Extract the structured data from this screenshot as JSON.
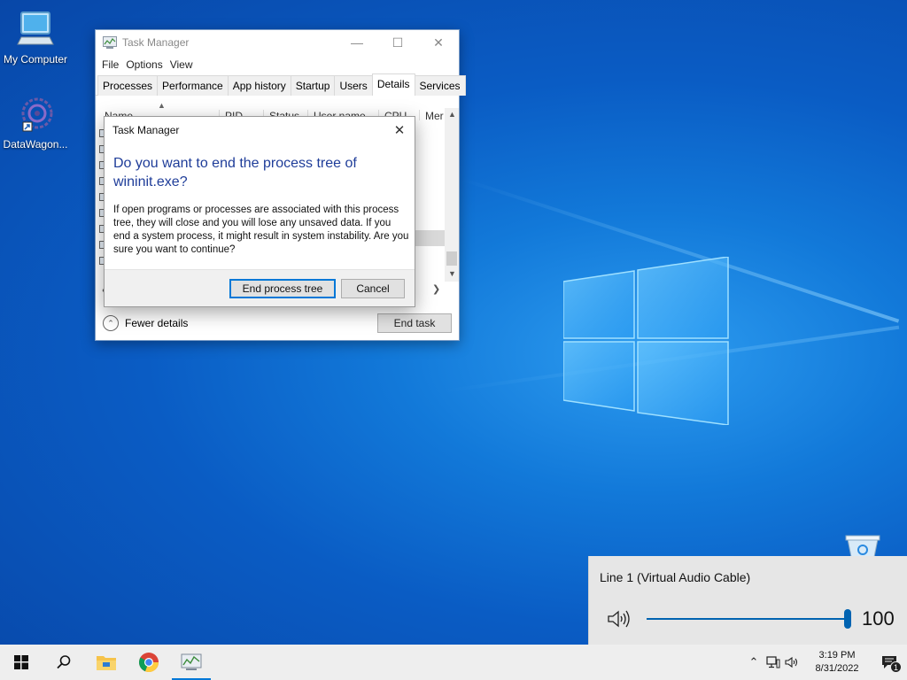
{
  "desktop": {
    "icons": [
      {
        "label": "My Computer",
        "icon": "computer-icon"
      },
      {
        "label": "DataWagon...",
        "icon": "shortcut-app-icon"
      },
      {
        "label": "",
        "icon": "recycle-bin-icon"
      }
    ]
  },
  "task_manager": {
    "title": "Task Manager",
    "menu": [
      "File",
      "Options",
      "View"
    ],
    "tabs": [
      "Processes",
      "Performance",
      "App history",
      "Startup",
      "Users",
      "Details",
      "Services"
    ],
    "active_tab": "Details",
    "columns": [
      "Name",
      "PID",
      "Status",
      "User name",
      "CPU",
      "Mer"
    ],
    "footer": {
      "fewer_details": "Fewer details",
      "end_task": "End task"
    }
  },
  "dialog": {
    "title": "Task Manager",
    "heading": "Do you want to end the process tree of wininit.exe?",
    "body": "If open programs or processes are associated with this process tree, they will close and you will lose any unsaved data. If you end a system process, it might result in system instability. Are you sure you want to continue?",
    "primary_button": "End process tree",
    "cancel_button": "Cancel"
  },
  "volume": {
    "device": "Line 1 (Virtual Audio Cable)",
    "level": 100,
    "level_text": "100"
  },
  "taskbar": {
    "pinned": [
      "start-icon",
      "search-icon",
      "file-explorer-icon",
      "chrome-icon",
      "task-manager-icon"
    ],
    "clock_time": "3:19 PM",
    "clock_date": "8/31/2022",
    "notification_count": "1"
  },
  "colors": {
    "accent": "#0078d7",
    "dialog_heading": "#1f3d99",
    "slider": "#0063b1",
    "taskbar": "#eeeeee"
  }
}
